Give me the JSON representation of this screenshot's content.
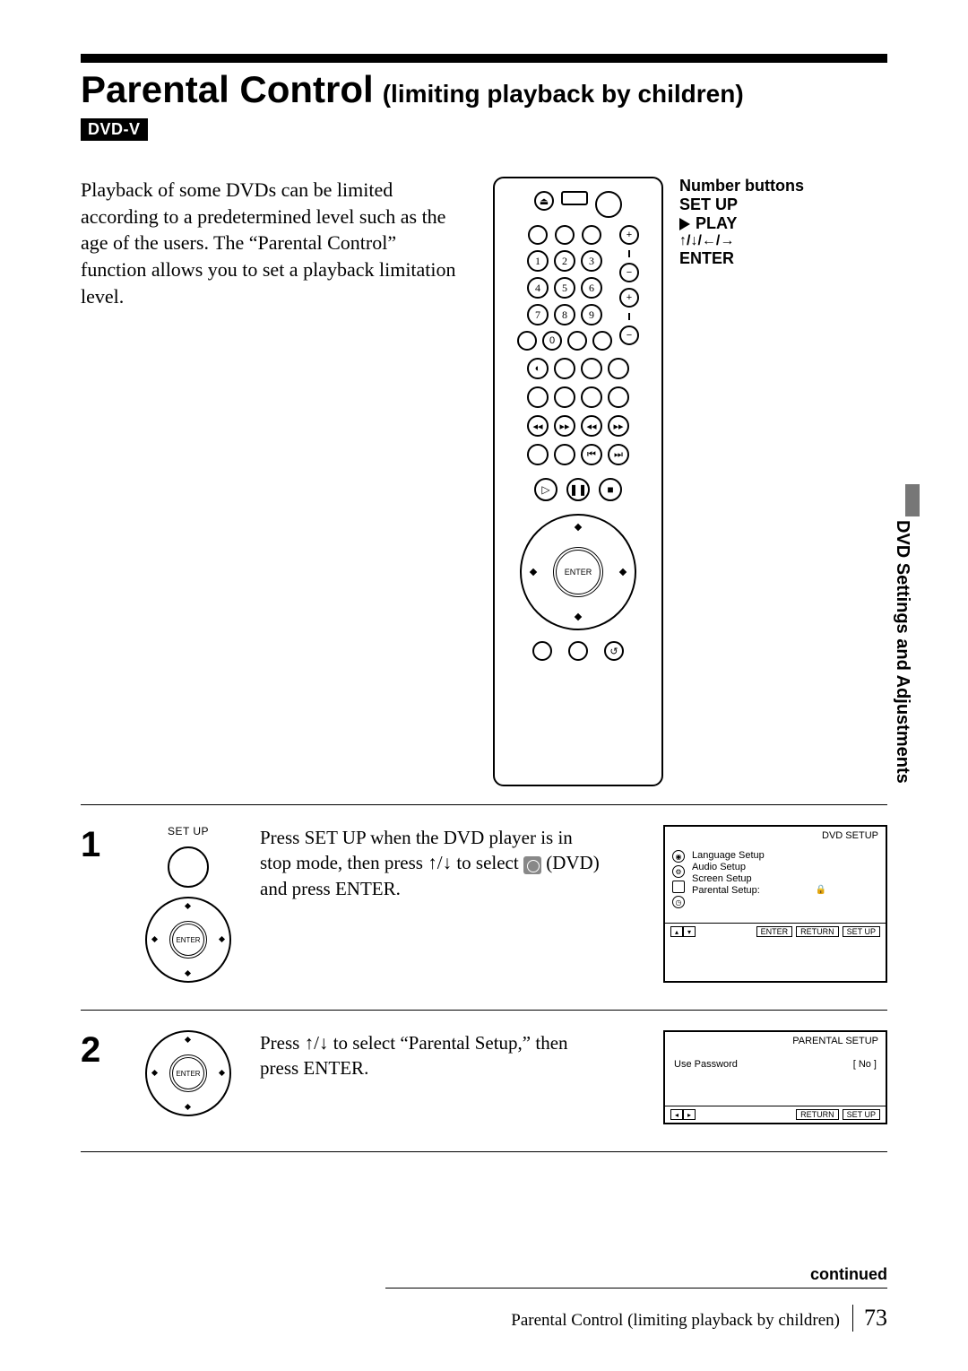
{
  "title": {
    "main": "Parental Control",
    "sub": "(limiting playback by children)"
  },
  "badge": "DVD-V",
  "intro": "Playback of some DVDs can be limited according to a predetermined level such as the age of the users.  The “Parental Control” function allows you to set a playback limitation level.",
  "remote_labels": {
    "number": "Number buttons",
    "setup": "SET UP",
    "play": "PLAY",
    "arrows": "↑/↓/←/→",
    "enter": "ENTER",
    "enter_btn": "ENTER"
  },
  "keypad_digits": [
    "1",
    "2",
    "3",
    "4",
    "5",
    "6",
    "7",
    "8",
    "9"
  ],
  "side_tab": "DVD Settings and Adjustments",
  "steps": {
    "s1": {
      "num": "1",
      "icon_label": "SET UP",
      "text_a": "Press SET UP when the DVD player is in stop mode, then press ",
      "text_arrows": "↑/↓",
      "text_b": " to select ",
      "text_c": " (DVD) and press ENTER."
    },
    "s2": {
      "num": "2",
      "text_a": "Press ",
      "text_arrows": "↑/↓",
      "text_b": " to select “Parental Setup,” then press ENTER."
    }
  },
  "screen1": {
    "header": "DVD SETUP",
    "items": [
      "Language Setup",
      "Audio Setup",
      "Screen Setup",
      "Parental Setup:"
    ],
    "footer_buttons": [
      "ENTER",
      "RETURN",
      "SET UP"
    ]
  },
  "screen2": {
    "header": "PARENTAL SETUP",
    "row_label": "Use Password",
    "row_value": "[ No ]",
    "footer_buttons": [
      "RETURN",
      "SET UP"
    ]
  },
  "footer": {
    "continued": "continued",
    "caption": "Parental Control (limiting playback by children)",
    "page": "73"
  }
}
